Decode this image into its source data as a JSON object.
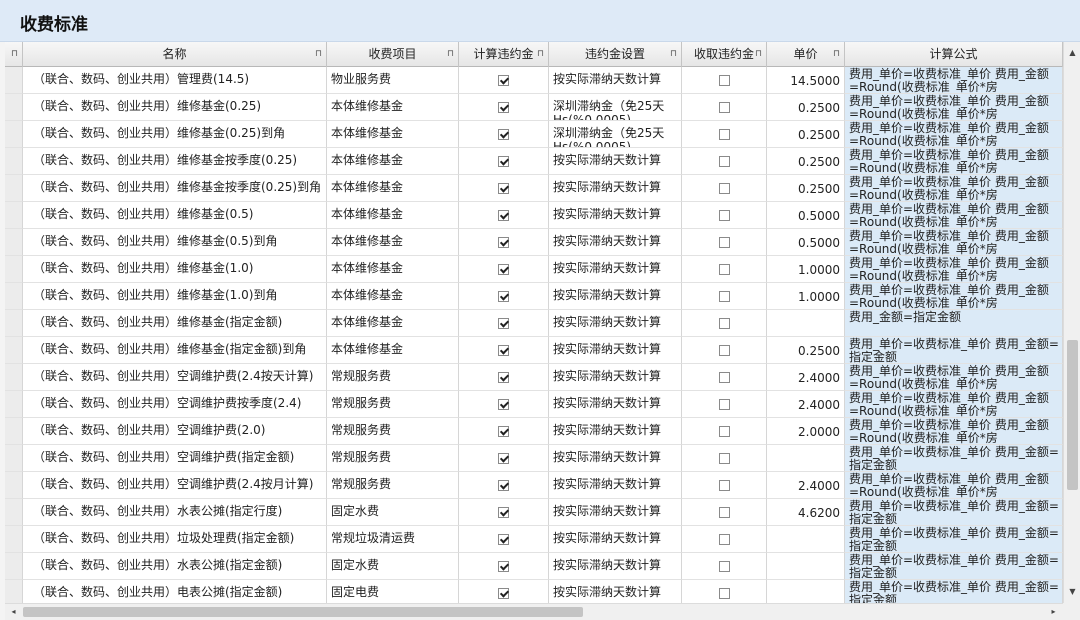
{
  "window": {
    "title": "收费标准"
  },
  "columns": [
    {
      "label": "",
      "pin": "⊓"
    },
    {
      "label": "名称",
      "pin": "⊓"
    },
    {
      "label": "收费项目",
      "pin": "⊓"
    },
    {
      "label": "计算违约金",
      "pin": "⊓"
    },
    {
      "label": "违约金设置",
      "pin": "⊓"
    },
    {
      "label": "收取违约金",
      "pin": "⊓"
    },
    {
      "label": "单价",
      "pin": "⊓"
    },
    {
      "label": "计算公式",
      "pin": ""
    }
  ],
  "rows": [
    {
      "name": "（联合、数码、创业共用）管理费(14.5)",
      "item": "物业服务费",
      "calc_penalty": true,
      "setting": "按实际滞纳天数计算",
      "collect_penalty": false,
      "price": "14.5000",
      "formula": "费用_单价=收费标准_单价 费用_金额=Round(收费标准_单价*房"
    },
    {
      "name": "（联合、数码、创业共用）维修基金(0.25)",
      "item": "本体维修基金",
      "calc_penalty": true,
      "setting": "深圳滞纳金（免25天 Hs(%0.0005)",
      "collect_penalty": false,
      "price": "0.2500",
      "formula": "费用_单价=收费标准_单价 费用_金额=Round(收费标准_单价*房"
    },
    {
      "name": "（联合、数码、创业共用）维修基金(0.25)到角",
      "item": "本体维修基金",
      "calc_penalty": true,
      "setting": "深圳滞纳金（免25天 Hs(%0.0005)",
      "collect_penalty": false,
      "price": "0.2500",
      "formula": "费用_单价=收费标准_单价 费用_金额=Round(收费标准_单价*房"
    },
    {
      "name": "（联合、数码、创业共用）维修基金按季度(0.25)",
      "item": "本体维修基金",
      "calc_penalty": true,
      "setting": "按实际滞纳天数计算",
      "collect_penalty": false,
      "price": "0.2500",
      "formula": "费用_单价=收费标准_单价 费用_金额=Round(收费标准_单价*房"
    },
    {
      "name": "（联合、数码、创业共用）维修基金按季度(0.25)到角",
      "item": "本体维修基金",
      "calc_penalty": true,
      "setting": "按实际滞纳天数计算",
      "collect_penalty": false,
      "price": "0.2500",
      "formula": "费用_单价=收费标准_单价 费用_金额=Round(收费标准_单价*房"
    },
    {
      "name": "（联合、数码、创业共用）维修基金(0.5)",
      "item": "本体维修基金",
      "calc_penalty": true,
      "setting": "按实际滞纳天数计算",
      "collect_penalty": false,
      "price": "0.5000",
      "formula": "费用_单价=收费标准_单价 费用_金额=Round(收费标准_单价*房"
    },
    {
      "name": "（联合、数码、创业共用）维修基金(0.5)到角",
      "item": "本体维修基金",
      "calc_penalty": true,
      "setting": "按实际滞纳天数计算",
      "collect_penalty": false,
      "price": "0.5000",
      "formula": "费用_单价=收费标准_单价 费用_金额=Round(收费标准_单价*房"
    },
    {
      "name": "（联合、数码、创业共用）维修基金(1.0)",
      "item": "本体维修基金",
      "calc_penalty": true,
      "setting": "按实际滞纳天数计算",
      "collect_penalty": false,
      "price": "1.0000",
      "formula": "费用_单价=收费标准_单价 费用_金额=Round(收费标准_单价*房"
    },
    {
      "name": "（联合、数码、创业共用）维修基金(1.0)到角",
      "item": "本体维修基金",
      "calc_penalty": true,
      "setting": "按实际滞纳天数计算",
      "collect_penalty": false,
      "price": "1.0000",
      "formula": "费用_单价=收费标准_单价 费用_金额=Round(收费标准_单价*房"
    },
    {
      "name": "（联合、数码、创业共用）维修基金(指定金额)",
      "item": "本体维修基金",
      "calc_penalty": true,
      "setting": "按实际滞纳天数计算",
      "collect_penalty": false,
      "price": "",
      "formula": "费用_金额=指定金额"
    },
    {
      "name": "（联合、数码、创业共用）维修基金(指定金额)到角",
      "item": "本体维修基金",
      "calc_penalty": true,
      "setting": "按实际滞纳天数计算",
      "collect_penalty": false,
      "price": "0.2500",
      "formula": "费用_单价=收费标准_单价 费用_金额=指定金额"
    },
    {
      "name": "（联合、数码、创业共用）空调维护费(2.4按天计算)",
      "item": "常规服务费",
      "calc_penalty": true,
      "setting": "按实际滞纳天数计算",
      "collect_penalty": false,
      "price": "2.4000",
      "formula": "费用_单价=收费标准_单价 费用_金额=Round(收费标准_单价*房"
    },
    {
      "name": "（联合、数码、创业共用）空调维护费按季度(2.4)",
      "item": "常规服务费",
      "calc_penalty": true,
      "setting": "按实际滞纳天数计算",
      "collect_penalty": false,
      "price": "2.4000",
      "formula": "费用_单价=收费标准_单价 费用_金额=Round(收费标准_单价*房"
    },
    {
      "name": "（联合、数码、创业共用）空调维护费(2.0)",
      "item": "常规服务费",
      "calc_penalty": true,
      "setting": "按实际滞纳天数计算",
      "collect_penalty": false,
      "price": "2.0000",
      "formula": "费用_单价=收费标准_单价 费用_金额=Round(收费标准_单价*房"
    },
    {
      "name": "（联合、数码、创业共用）空调维护费(指定金额)",
      "item": "常规服务费",
      "calc_penalty": true,
      "setting": "按实际滞纳天数计算",
      "collect_penalty": false,
      "price": "",
      "formula": "费用_单价=收费标准_单价 费用_金额=指定金额"
    },
    {
      "name": "（联合、数码、创业共用）空调维护费(2.4按月计算)",
      "item": "常规服务费",
      "calc_penalty": true,
      "setting": "按实际滞纳天数计算",
      "collect_penalty": false,
      "price": "2.4000",
      "formula": "费用_单价=收费标准_单价 费用_金额=Round(收费标准_单价*房"
    },
    {
      "name": "（联合、数码、创业共用）水表公摊(指定行度)",
      "item": "固定水费",
      "calc_penalty": true,
      "setting": "按实际滞纳天数计算",
      "collect_penalty": false,
      "price": "4.6200",
      "formula": "费用_单价=收费标准_单价 费用_金额=指定金额"
    },
    {
      "name": "（联合、数码、创业共用）垃圾处理费(指定金额)",
      "item": "常规垃圾清运费",
      "calc_penalty": true,
      "setting": "按实际滞纳天数计算",
      "collect_penalty": false,
      "price": "",
      "formula": "费用_单价=收费标准_单价 费用_金额=指定金额"
    },
    {
      "name": "（联合、数码、创业共用）水表公摊(指定金额)",
      "item": "固定水费",
      "calc_penalty": true,
      "setting": "按实际滞纳天数计算",
      "collect_penalty": false,
      "price": "",
      "formula": "费用_单价=收费标准_单价 费用_金额=指定金额"
    },
    {
      "name": "（联合、数码、创业共用）电表公摊(指定金额)",
      "item": "固定电费",
      "calc_penalty": true,
      "setting": "按实际滞纳天数计算",
      "collect_penalty": false,
      "price": "",
      "formula": "费用_单价=收费标准_单价 费用_金额=指定金额"
    }
  ],
  "scroll": {
    "up": "▲",
    "down": "▼",
    "left": "◂",
    "right": "▸"
  }
}
